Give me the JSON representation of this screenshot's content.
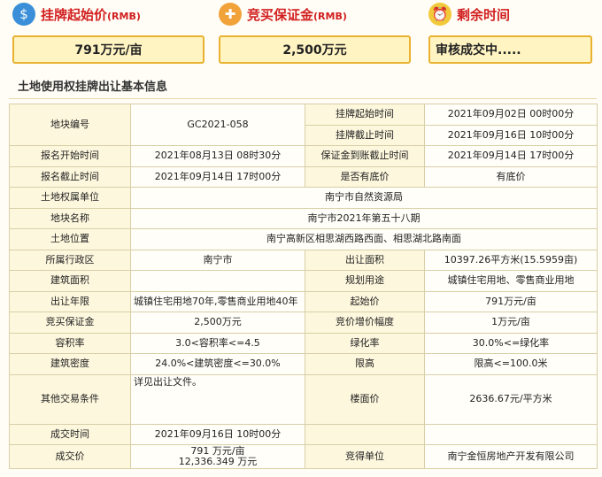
{
  "header": {
    "start_price_title": "挂牌起始价",
    "start_price_unit": "(RMB)",
    "deposit_title": "竞买保证金",
    "deposit_unit": "(RMB)",
    "remaining_title": "剩余时间",
    "start_price_value": "791万元/亩",
    "deposit_value": "2,500万元",
    "remaining_value": "审核成交中....."
  },
  "section_title": "土地使用权挂牌出让基本信息",
  "table": {
    "r1": {
      "l1": "地块编号",
      "v1": "GC2021-058",
      "l2": "挂牌起始时间",
      "v2": "2021年09月02日 00时00分"
    },
    "r2": {
      "l2": "挂牌截止时间",
      "v2": "2021年09月16日 10时00分"
    },
    "r3": {
      "l1": "报名开始时间",
      "v1": "2021年08月13日 08时30分",
      "l2": "保证金到账截止时间",
      "v2": "2021年09月14日 17时00分"
    },
    "r4": {
      "l1": "报名截止时间",
      "v1": "2021年09月14日 17时00分",
      "l2": "是否有底价",
      "v2": "有底价"
    },
    "r5": {
      "l1": "土地权属单位",
      "v1": "南宁市自然资源局"
    },
    "r6": {
      "l1": "地块名称",
      "v1": "南宁市2021年第五十八期"
    },
    "r7": {
      "l1": "土地位置",
      "v1": "南宁高新区相思湖西路西面、相思湖北路南面"
    },
    "r8": {
      "l1": "所属行政区",
      "v1": "南宁市",
      "l2": "出让面积",
      "v2": "10397.26平方米(15.5959亩)"
    },
    "r9": {
      "l1": "建筑面积",
      "v1": "",
      "l2": "规划用途",
      "v2": "城镇住宅用地、零售商业用地"
    },
    "r10": {
      "l1": "出让年限",
      "v1": "城镇住宅用地70年,零售商业用地40年",
      "l2": "起始价",
      "v2": "791万元/亩"
    },
    "r11": {
      "l1": "竞买保证金",
      "v1": "2,500万元",
      "l2": "竞价增价幅度",
      "v2": "1万元/亩"
    },
    "r12": {
      "l1": "容积率",
      "v1": "3.0<容积率<=4.5",
      "l2": "绿化率",
      "v2": "30.0%<=绿化率"
    },
    "r13": {
      "l1": "建筑密度",
      "v1": "24.0%<建筑密度<=30.0%",
      "l2": "限高",
      "v2": "限高<=100.0米"
    },
    "r14": {
      "l1": "其他交易条件",
      "v1": "详见出让文件。",
      "l2": "楼面价",
      "v2": "2636.67元/平方米"
    },
    "r15": {
      "l1": "成交时间",
      "v1": "2021年09月16日 10时00分"
    },
    "r16": {
      "l1": "成交价",
      "v1a": "791 万元/亩",
      "v1b": "12,336.349 万元",
      "l2": "竞得单位",
      "v2": "南宁金恒房地产开发有限公司"
    }
  },
  "colors": {
    "accent": "#d21f1f",
    "box_border": "#e9b230",
    "box_bg": "#fff4c2"
  },
  "icons": [
    "price-tag-icon",
    "gift-icon",
    "alarm-clock-icon"
  ]
}
